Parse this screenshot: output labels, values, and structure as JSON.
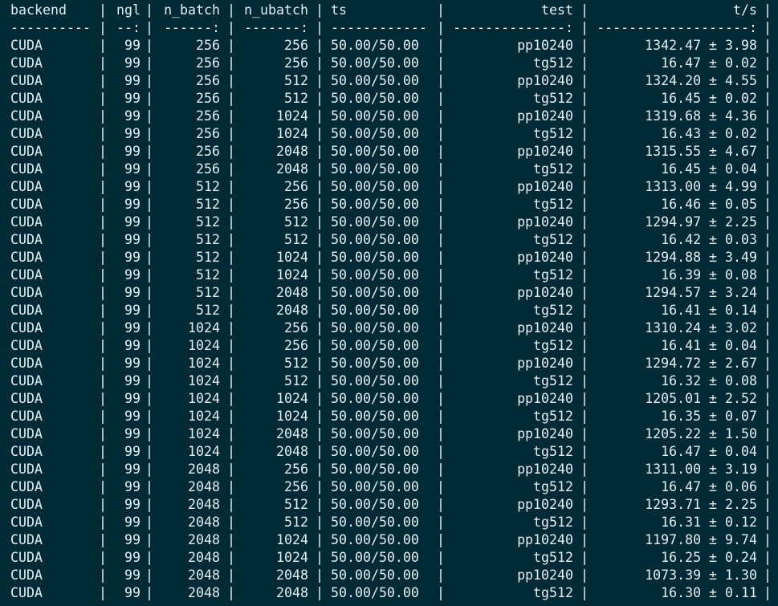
{
  "terminal": {
    "headers": [
      "backend",
      "ngl",
      "n_batch",
      "n_ubatch",
      "ts",
      "test",
      "t/s"
    ],
    "separators": [
      "----------",
      "--:",
      "------:",
      "-------:",
      "------------",
      "--------------:",
      "-------------------:"
    ],
    "rows": [
      [
        "CUDA",
        "99",
        "256",
        "256",
        "50.00/50.00",
        "pp10240",
        "1342.47 ± 3.98"
      ],
      [
        "CUDA",
        "99",
        "256",
        "256",
        "50.00/50.00",
        "tg512",
        "16.47 ± 0.02"
      ],
      [
        "CUDA",
        "99",
        "256",
        "512",
        "50.00/50.00",
        "pp10240",
        "1324.20 ± 4.55"
      ],
      [
        "CUDA",
        "99",
        "256",
        "512",
        "50.00/50.00",
        "tg512",
        "16.45 ± 0.02"
      ],
      [
        "CUDA",
        "99",
        "256",
        "1024",
        "50.00/50.00",
        "pp10240",
        "1319.68 ± 4.36"
      ],
      [
        "CUDA",
        "99",
        "256",
        "1024",
        "50.00/50.00",
        "tg512",
        "16.43 ± 0.02"
      ],
      [
        "CUDA",
        "99",
        "256",
        "2048",
        "50.00/50.00",
        "pp10240",
        "1315.55 ± 4.67"
      ],
      [
        "CUDA",
        "99",
        "256",
        "2048",
        "50.00/50.00",
        "tg512",
        "16.45 ± 0.04"
      ],
      [
        "CUDA",
        "99",
        "512",
        "256",
        "50.00/50.00",
        "pp10240",
        "1313.00 ± 4.99"
      ],
      [
        "CUDA",
        "99",
        "512",
        "256",
        "50.00/50.00",
        "tg512",
        "16.46 ± 0.05"
      ],
      [
        "CUDA",
        "99",
        "512",
        "512",
        "50.00/50.00",
        "pp10240",
        "1294.97 ± 2.25"
      ],
      [
        "CUDA",
        "99",
        "512",
        "512",
        "50.00/50.00",
        "tg512",
        "16.42 ± 0.03"
      ],
      [
        "CUDA",
        "99",
        "512",
        "1024",
        "50.00/50.00",
        "pp10240",
        "1294.88 ± 3.49"
      ],
      [
        "CUDA",
        "99",
        "512",
        "1024",
        "50.00/50.00",
        "tg512",
        "16.39 ± 0.08"
      ],
      [
        "CUDA",
        "99",
        "512",
        "2048",
        "50.00/50.00",
        "pp10240",
        "1294.57 ± 3.24"
      ],
      [
        "CUDA",
        "99",
        "512",
        "2048",
        "50.00/50.00",
        "tg512",
        "16.41 ± 0.14"
      ],
      [
        "CUDA",
        "99",
        "1024",
        "256",
        "50.00/50.00",
        "pp10240",
        "1310.24 ± 3.02"
      ],
      [
        "CUDA",
        "99",
        "1024",
        "256",
        "50.00/50.00",
        "tg512",
        "16.41 ± 0.04"
      ],
      [
        "CUDA",
        "99",
        "1024",
        "512",
        "50.00/50.00",
        "pp10240",
        "1294.72 ± 2.67"
      ],
      [
        "CUDA",
        "99",
        "1024",
        "512",
        "50.00/50.00",
        "tg512",
        "16.32 ± 0.08"
      ],
      [
        "CUDA",
        "99",
        "1024",
        "1024",
        "50.00/50.00",
        "pp10240",
        "1205.01 ± 2.52"
      ],
      [
        "CUDA",
        "99",
        "1024",
        "1024",
        "50.00/50.00",
        "tg512",
        "16.35 ± 0.07"
      ],
      [
        "CUDA",
        "99",
        "1024",
        "2048",
        "50.00/50.00",
        "pp10240",
        "1205.22 ± 1.50"
      ],
      [
        "CUDA",
        "99",
        "1024",
        "2048",
        "50.00/50.00",
        "tg512",
        "16.47 ± 0.04"
      ],
      [
        "CUDA",
        "99",
        "2048",
        "256",
        "50.00/50.00",
        "pp10240",
        "1311.00 ± 3.19"
      ],
      [
        "CUDA",
        "99",
        "2048",
        "256",
        "50.00/50.00",
        "tg512",
        "16.47 ± 0.06"
      ],
      [
        "CUDA",
        "99",
        "2048",
        "512",
        "50.00/50.00",
        "pp10240",
        "1293.71 ± 2.25"
      ],
      [
        "CUDA",
        "99",
        "2048",
        "512",
        "50.00/50.00",
        "tg512",
        "16.31 ± 0.12"
      ],
      [
        "CUDA",
        "99",
        "2048",
        "1024",
        "50.00/50.00",
        "pp10240",
        "1197.80 ± 9.74"
      ],
      [
        "CUDA",
        "99",
        "2048",
        "1024",
        "50.00/50.00",
        "tg512",
        "16.25 ± 0.24"
      ],
      [
        "CUDA",
        "99",
        "2048",
        "2048",
        "50.00/50.00",
        "pp10240",
        "1073.39 ± 1.30"
      ],
      [
        "CUDA",
        "99",
        "2048",
        "2048",
        "50.00/50.00",
        "tg512",
        "16.30 ± 0.11"
      ]
    ],
    "pipe": "|",
    "colors": {
      "background": "#002b36",
      "foreground": "#e6eef0"
    }
  }
}
